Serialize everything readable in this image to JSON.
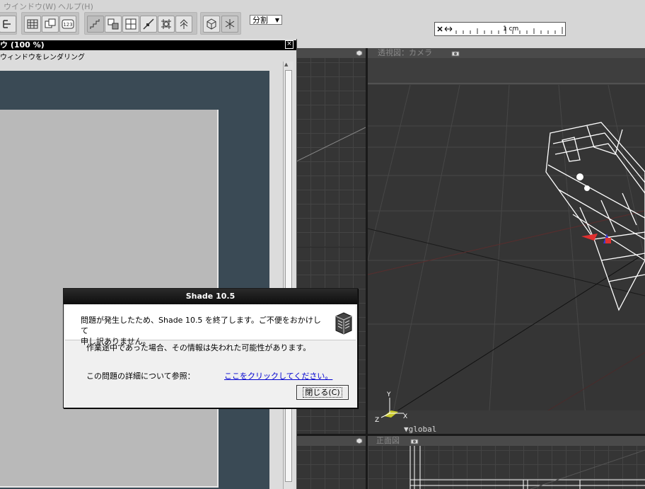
{
  "menubar": {
    "items": [
      "ウインドウ(W)",
      "ヘルプ(H)"
    ]
  },
  "toolbar": {
    "split_select": "分割",
    "ruler_label": "1 cm"
  },
  "render_window": {
    "title": "ウ (100 %)",
    "menu_text": "ウィンドウをレンダリング"
  },
  "viewports": {
    "perspective_title": "透視図：カメラ",
    "front_title": "正面図",
    "coord_label": "▼global",
    "axis_y": "Y",
    "axis_x": "X",
    "axis_z": "Z"
  },
  "dialog": {
    "title": "Shade 10.5",
    "message_line1": "問題が発生したため、Shade 10.5 を終了します。ご不便をおかけして",
    "message_line2": "申し訳ありません。",
    "message_info": "作業途中であった場合、その情報は失われた可能性があります。",
    "detail_label": "この問題の詳細について参照：",
    "link_text": "ここをクリックしてください。",
    "close_button": "閉じる(C)"
  },
  "colors": {
    "viewport_bg": "#353535",
    "dialog_title_bg": "#111111",
    "link": "#0000d0",
    "wireframe": "#ffffff"
  }
}
